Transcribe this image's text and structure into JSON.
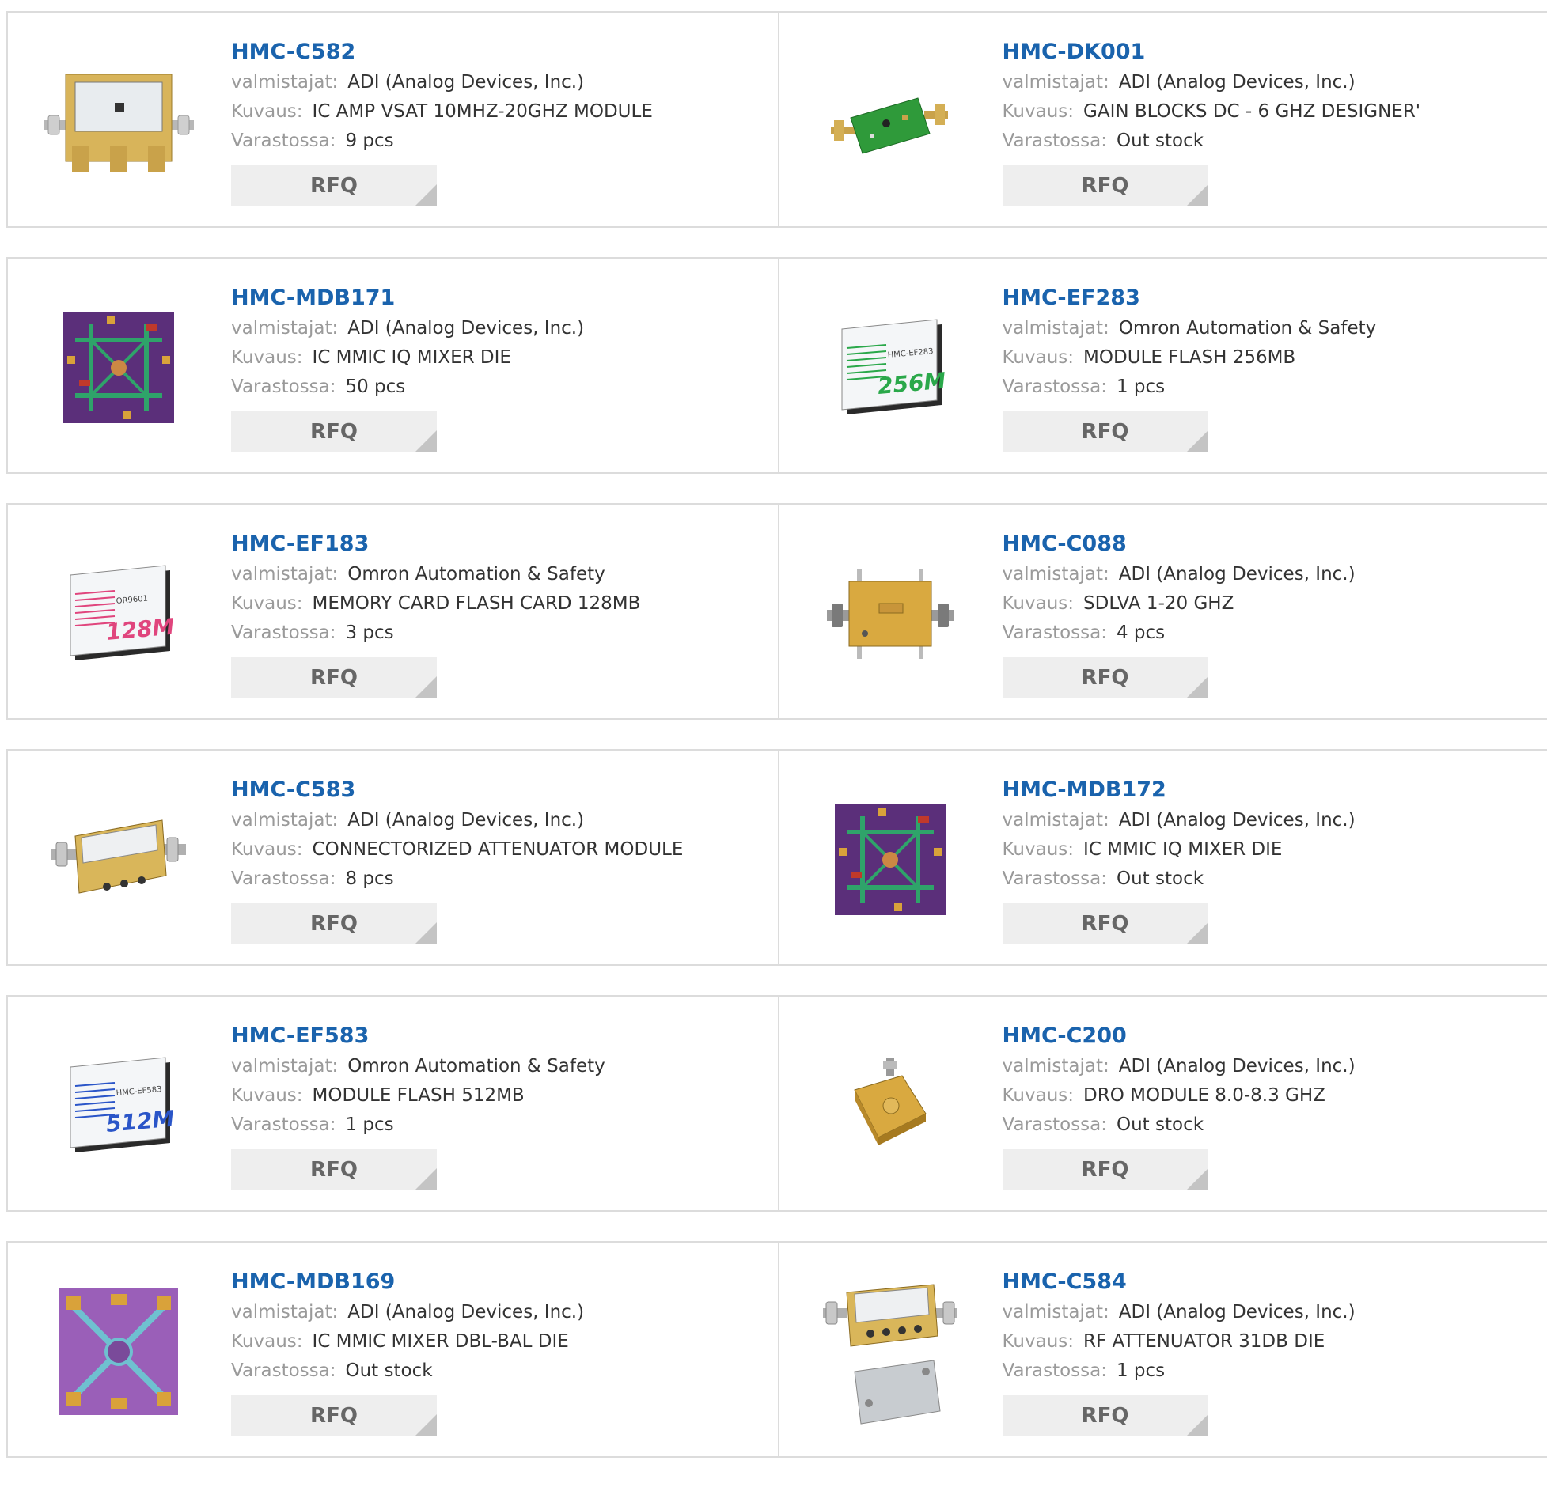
{
  "labels": {
    "manufacturer": "valmistajat:",
    "description": "Kuvaus:",
    "stock": "Varastossa:",
    "rfq_button": "RFQ"
  },
  "colors": {
    "part_number": "#1a63ad",
    "label": "#9a9a9a",
    "value": "#333333",
    "border": "#dcdcdc",
    "button_bg": "#eeeeee"
  },
  "products": [
    {
      "part_number": "HMC-C582",
      "manufacturer": "ADI (Analog Devices, Inc.)",
      "description": "IC AMP VSAT 10MHZ-20GHZ MODULE",
      "stock": "9 pcs",
      "image": "amplifier-module-image"
    },
    {
      "part_number": "HMC-DK001",
      "manufacturer": "ADI (Analog Devices, Inc.)",
      "description": "GAIN BLOCKS DC - 6 GHZ DESIGNER'",
      "stock": "Out stock",
      "image": "eval-board-image"
    },
    {
      "part_number": "HMC-MDB171",
      "manufacturer": "ADI (Analog Devices, Inc.)",
      "description": "IC MMIC IQ MIXER DIE",
      "stock": "50 pcs",
      "image": "mmic-die-image"
    },
    {
      "part_number": "HMC-EF283",
      "manufacturer": "Omron Automation & Safety",
      "description": "MODULE FLASH 256MB",
      "stock": "1 pcs",
      "image": "flash-card-256m-image"
    },
    {
      "part_number": "HMC-EF183",
      "manufacturer": "Omron Automation & Safety",
      "description": "MEMORY CARD FLASH CARD 128MB",
      "stock": "3 pcs",
      "image": "flash-card-128m-image"
    },
    {
      "part_number": "HMC-C088",
      "manufacturer": "ADI (Analog Devices, Inc.)",
      "description": "SDLVA 1-20 GHZ",
      "stock": "4 pcs",
      "image": "sdlva-module-image"
    },
    {
      "part_number": "HMC-C583",
      "manufacturer": "ADI (Analog Devices, Inc.)",
      "description": "CONNECTORIZED ATTENUATOR MODULE",
      "stock": "8 pcs",
      "image": "attenuator-module-image"
    },
    {
      "part_number": "HMC-MDB172",
      "manufacturer": "ADI (Analog Devices, Inc.)",
      "description": "IC MMIC IQ MIXER DIE",
      "stock": "Out stock",
      "image": "mmic-die-image"
    },
    {
      "part_number": "HMC-EF583",
      "manufacturer": "Omron Automation & Safety",
      "description": "MODULE FLASH 512MB",
      "stock": "1 pcs",
      "image": "flash-card-512m-image"
    },
    {
      "part_number": "HMC-C200",
      "manufacturer": "ADI (Analog Devices, Inc.)",
      "description": "DRO MODULE 8.0-8.3 GHZ",
      "stock": "Out stock",
      "image": "dro-module-image"
    },
    {
      "part_number": "HMC-MDB169",
      "manufacturer": "ADI (Analog Devices, Inc.)",
      "description": "IC MMIC MIXER DBL-BAL DIE",
      "stock": "Out stock",
      "image": "mixer-die-image"
    },
    {
      "part_number": "HMC-C584",
      "manufacturer": "ADI (Analog Devices, Inc.)",
      "description": "RF ATTENUATOR 31DB DIE",
      "stock": "1 pcs",
      "image": "attenuator-die-image"
    }
  ],
  "flash_cards": {
    "256": {
      "text": "256M",
      "subtext": "HMC-EF283"
    },
    "128": {
      "text": "128M",
      "subtext": "OR9601"
    },
    "512": {
      "text": "512M",
      "subtext": "HMC-EF583"
    }
  }
}
